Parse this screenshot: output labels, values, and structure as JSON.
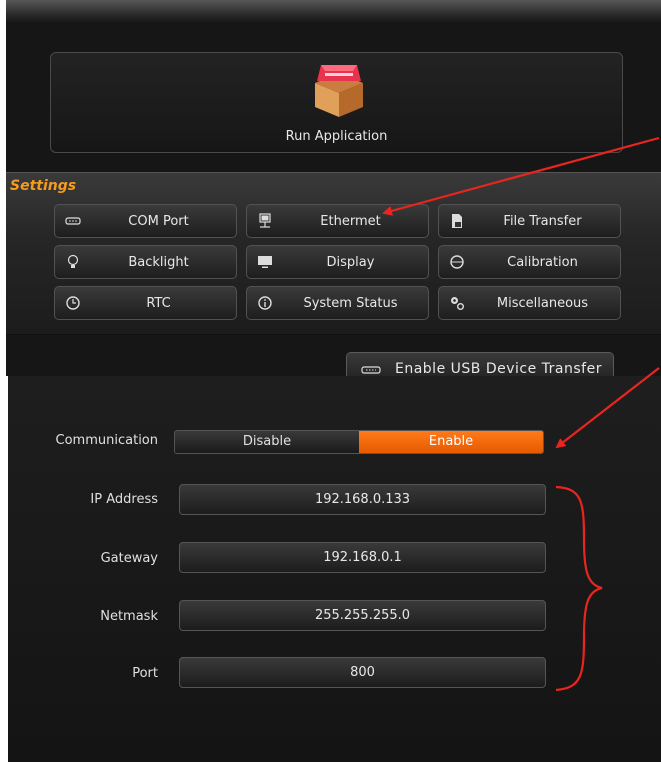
{
  "run_application": {
    "label": "Run Application",
    "icon": "package-box-icon"
  },
  "settings": {
    "title": "Settings",
    "buttons": [
      {
        "label": "COM Port",
        "icon": "serial-port-icon"
      },
      {
        "label": "Ethermet",
        "icon": "network-icon"
      },
      {
        "label": "File Transfer",
        "icon": "file-icon"
      },
      {
        "label": "Backlight",
        "icon": "lightbulb-icon"
      },
      {
        "label": "Display",
        "icon": "monitor-icon"
      },
      {
        "label": "Calibration",
        "icon": "crosshair-icon"
      },
      {
        "label": "RTC",
        "icon": "clock-icon"
      },
      {
        "label": "System Status",
        "icon": "info-icon"
      },
      {
        "label": "Miscellaneous",
        "icon": "gears-icon"
      }
    ]
  },
  "usb_transfer": {
    "label": "Enable USB Device Transfer",
    "icon": "usb-icon"
  },
  "ethernet": {
    "communication": {
      "label": "Communication",
      "options": [
        "Disable",
        "Enable"
      ],
      "selected": "Enable"
    },
    "fields": [
      {
        "label": "IP Address",
        "value": "192.168.0.133"
      },
      {
        "label": "Gateway",
        "value": "192.168.0.1"
      },
      {
        "label": "Netmask",
        "value": "255.255.255.0"
      },
      {
        "label": "Port",
        "value": "800"
      }
    ]
  },
  "colors": {
    "accent_orange": "#ff6a00",
    "settings_title": "#f39c1e",
    "annotation_red": "#e8251f",
    "panel_bg": "#161616"
  }
}
